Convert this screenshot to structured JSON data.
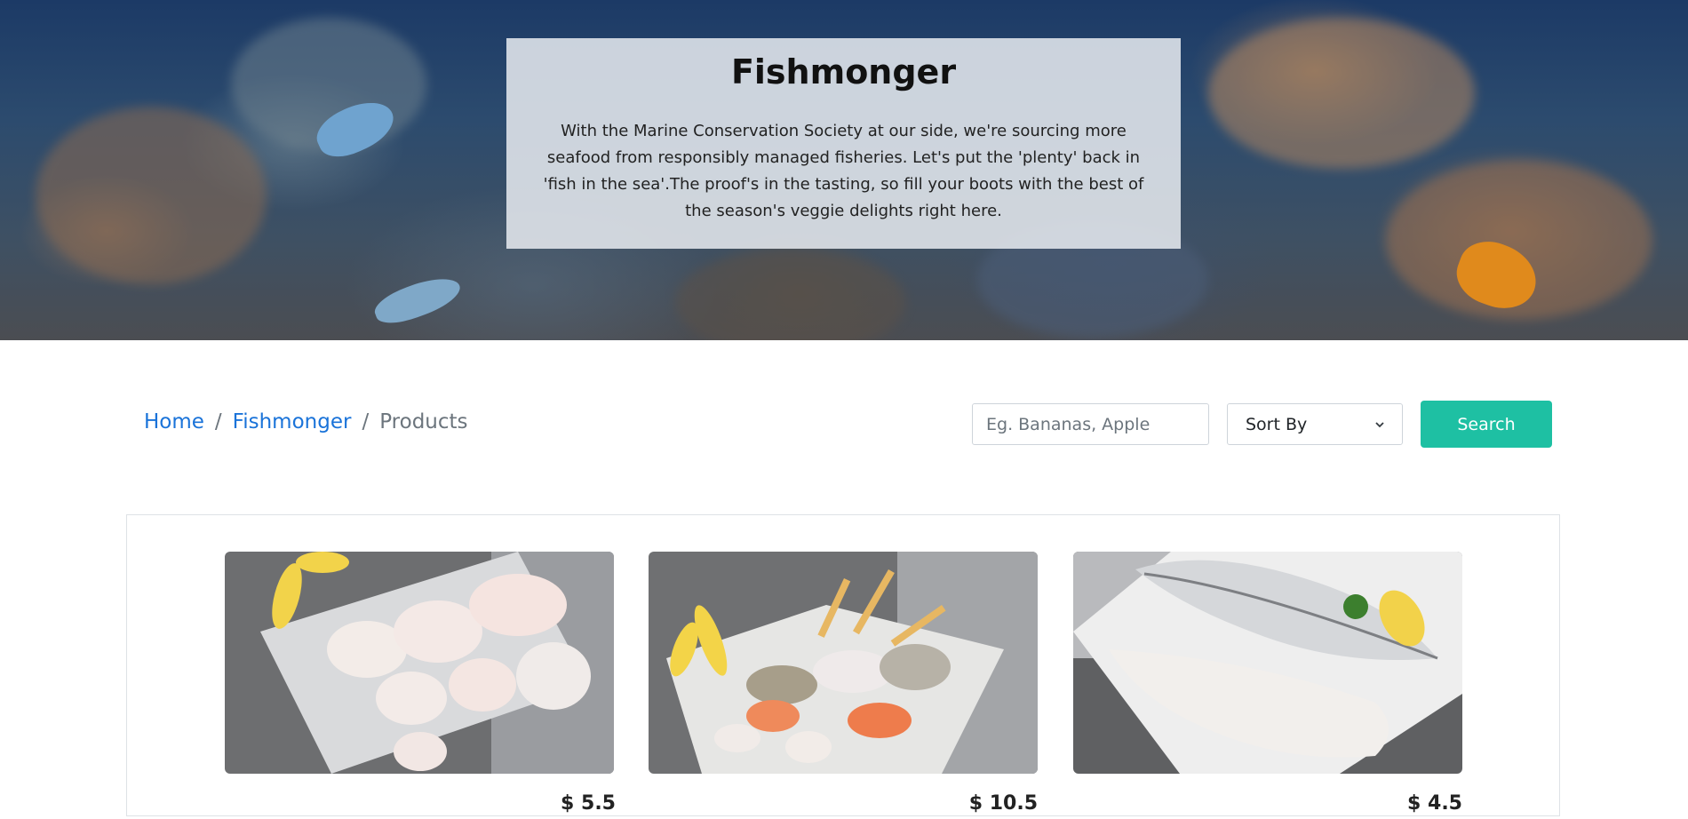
{
  "hero": {
    "title": "Fishmonger",
    "description": "With the Marine Conservation Society at our side, we're sourcing more seafood from responsibly managed fisheries. Let's put the 'plenty' back in 'fish in the sea'.The proof's in the tasting, so fill your boots with the best of the season's veggie delights right here."
  },
  "breadcrumb": {
    "items": [
      {
        "label": "Home"
      },
      {
        "label": "Fishmonger"
      },
      {
        "label": "Products"
      }
    ],
    "separator": "/"
  },
  "search": {
    "placeholder": "Eg. Bananas, Apple",
    "value": "",
    "button_label": "Search"
  },
  "sort": {
    "selected": "Sort By"
  },
  "products": [
    {
      "image": "white-fish-chunks-photo",
      "price": "$ 5.5"
    },
    {
      "image": "fish-skewers-photo",
      "price": "$ 10.5"
    },
    {
      "image": "white-fish-fillet-photo",
      "price": "$ 4.5"
    }
  ],
  "colors": {
    "accent": "#1ec0a3",
    "link": "#1a73d9",
    "muted": "#6c757d"
  }
}
